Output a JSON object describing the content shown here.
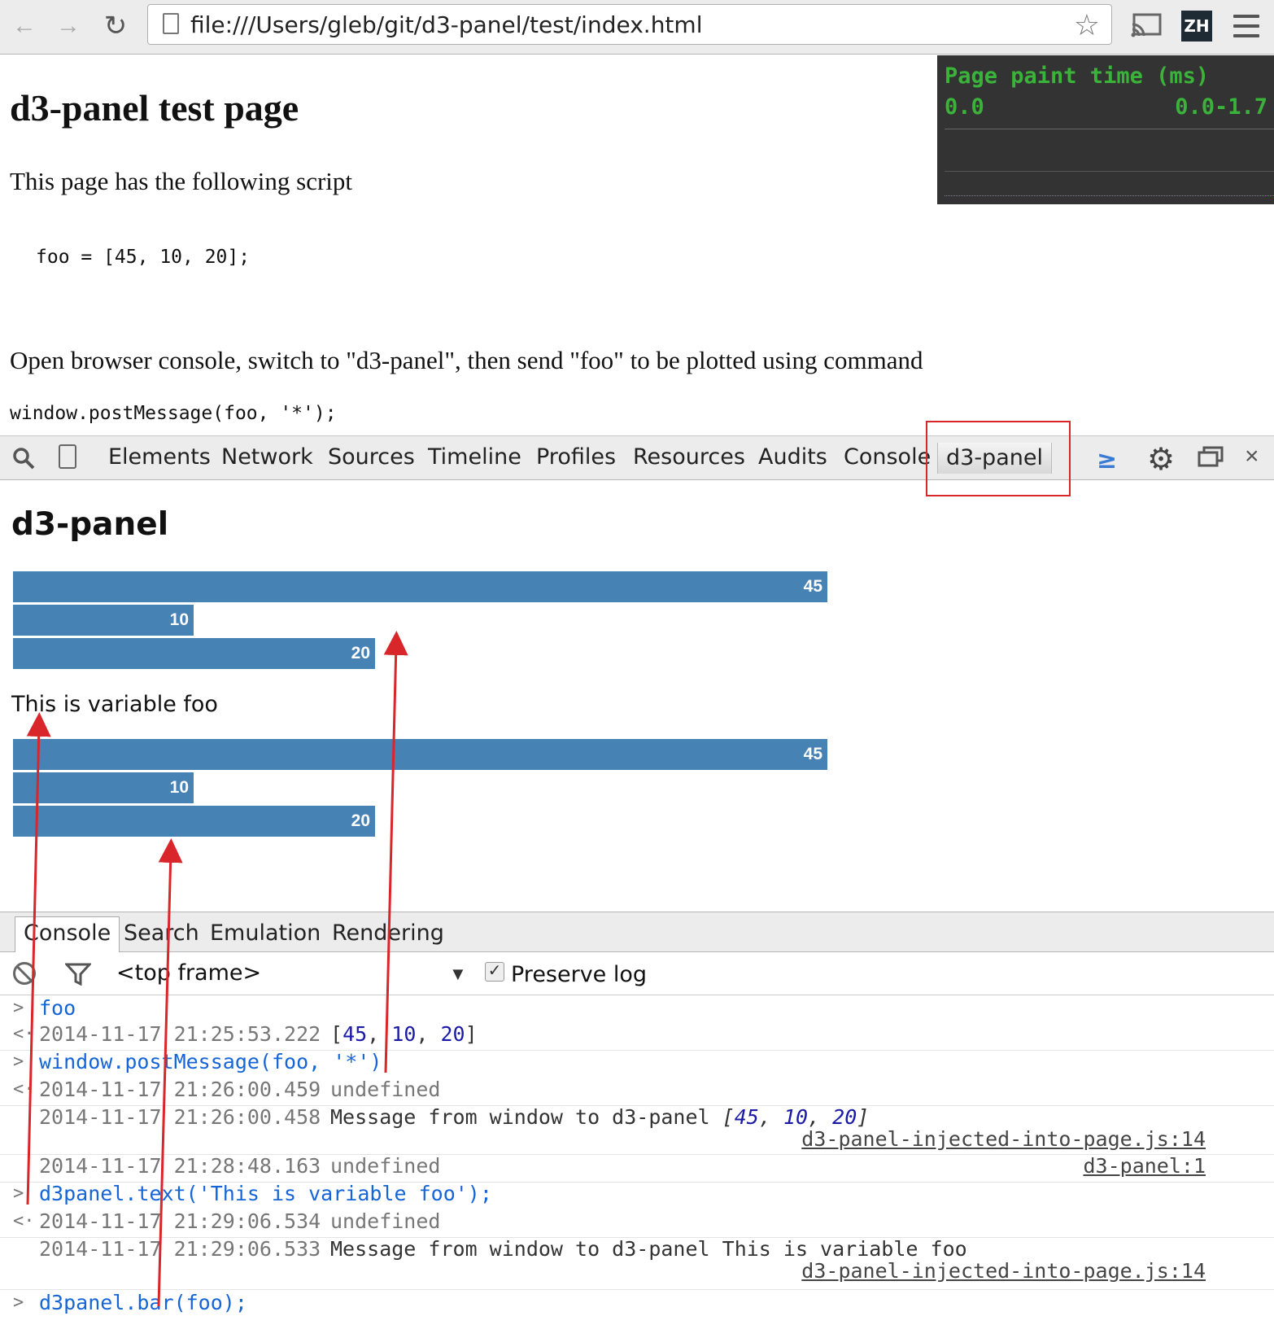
{
  "browser": {
    "url": "file:///Users/gleb/git/d3-panel/test/index.html",
    "extension_badge": "ZH"
  },
  "page": {
    "title": "d3-panel test page",
    "intro": "This page has the following script",
    "code": "foo = [45, 10, 20];",
    "instructions": "Open browser console, switch to \"d3-panel\", then send \"foo\" to be plotted using command",
    "command": "window.postMessage(foo, '*');"
  },
  "paint_overlay": {
    "title": "Page paint time (ms)",
    "value": "0.0",
    "range": "0.0-1.7"
  },
  "devtools": {
    "tabs": [
      "Elements",
      "Network",
      "Sources",
      "Timeline",
      "Profiles",
      "Resources",
      "Audits",
      "Console",
      "d3-panel"
    ],
    "active_tab": "d3-panel"
  },
  "d3panel": {
    "title": "d3-panel",
    "text": "This is variable foo",
    "chart_data": [
      {
        "type": "bar",
        "orientation": "horizontal",
        "values": [
          45,
          10,
          20
        ],
        "labels": [
          "45",
          "10",
          "20"
        ]
      },
      {
        "type": "bar",
        "orientation": "horizontal",
        "values": [
          45,
          10,
          20
        ],
        "labels": [
          "45",
          "10",
          "20"
        ]
      }
    ],
    "bar_color": "#4682b4"
  },
  "drawer": {
    "tabs": [
      "Console",
      "Search",
      "Emulation",
      "Rendering"
    ],
    "frame": "<top frame>",
    "preserve_log": "Preserve log"
  },
  "console": {
    "rows": [
      {
        "kind": "input",
        "command": "foo"
      },
      {
        "kind": "output",
        "timestamp": "2014-11-17 21:25:53.222",
        "array": [
          "45",
          "10",
          "20"
        ]
      },
      {
        "kind": "input",
        "command": "window.postMessage(foo, '*')"
      },
      {
        "kind": "output",
        "timestamp": "2014-11-17 21:26:00.459",
        "message": "undefined"
      },
      {
        "kind": "log",
        "timestamp": "2014-11-17 21:26:00.458",
        "message": "Message from window to d3-panel",
        "array": [
          "45",
          "10",
          "20"
        ],
        "source": "d3-panel-injected-into-page.js:14"
      },
      {
        "kind": "log",
        "timestamp": "2014-11-17 21:28:48.163",
        "message": "undefined",
        "source": "d3-panel:1"
      },
      {
        "kind": "input",
        "command": "d3panel.text('This is variable foo');"
      },
      {
        "kind": "output",
        "timestamp": "2014-11-17 21:29:06.534",
        "message": "undefined"
      },
      {
        "kind": "log",
        "timestamp": "2014-11-17 21:29:06.533",
        "message": "Message from window to d3-panel This is variable foo",
        "source": "d3-panel-injected-into-page.js:14"
      },
      {
        "kind": "input",
        "command": "d3panel.bar(foo);"
      }
    ]
  },
  "colors": {
    "annotation_red": "#d9262b",
    "console_blue": "#1565d8",
    "paint_green": "#3bb33b"
  }
}
